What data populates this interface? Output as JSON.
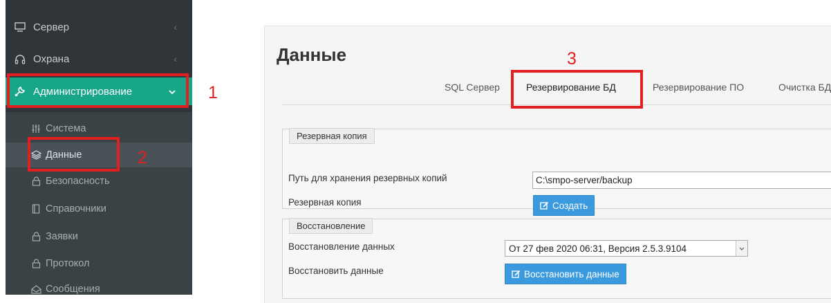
{
  "sidebar": {
    "top_items": [
      {
        "label": "Сервер",
        "icon": "monitor-icon"
      },
      {
        "label": "Охрана",
        "icon": "headset-icon"
      },
      {
        "label": "Администрирование",
        "icon": "wrench-icon"
      }
    ],
    "sub_items": [
      {
        "label": "Система",
        "icon": "sliders-icon"
      },
      {
        "label": "Данные",
        "icon": "layers-icon"
      },
      {
        "label": "Безопасность",
        "icon": "lock-icon"
      },
      {
        "label": "Справочники",
        "icon": "book-icon"
      },
      {
        "label": "Заявки",
        "icon": "lock-icon"
      },
      {
        "label": "Протокол",
        "icon": "lock-icon"
      },
      {
        "label": "Сообщения",
        "icon": "envelope-icon"
      }
    ]
  },
  "annotations": {
    "n1": "1",
    "n2": "2",
    "n3": "3"
  },
  "main": {
    "title": "Данные",
    "tabs": [
      {
        "label": "SQL Сервер"
      },
      {
        "label": "Резервирование БД"
      },
      {
        "label": "Резервирование ПО"
      },
      {
        "label": "Очистка БД"
      }
    ],
    "backup": {
      "legend": "Резервная копия",
      "path_label": "Путь для хранения резервных копий",
      "path_value": "C:\\smpo-server/backup",
      "copy_label": "Резервная копия",
      "create_button": "Создать"
    },
    "restore": {
      "legend": "Восстановление",
      "data_label": "Восстановление данных",
      "selected_version": "От 27 фев 2020 06:31, Версия 2.5.3.9104",
      "restore_label": "Восстановить данные",
      "restore_button": "Восстановить данные"
    }
  },
  "colors": {
    "sidebar": "#2f3539",
    "accent": "#18a689",
    "button": "#3a9add",
    "annotation": "#e02020"
  }
}
